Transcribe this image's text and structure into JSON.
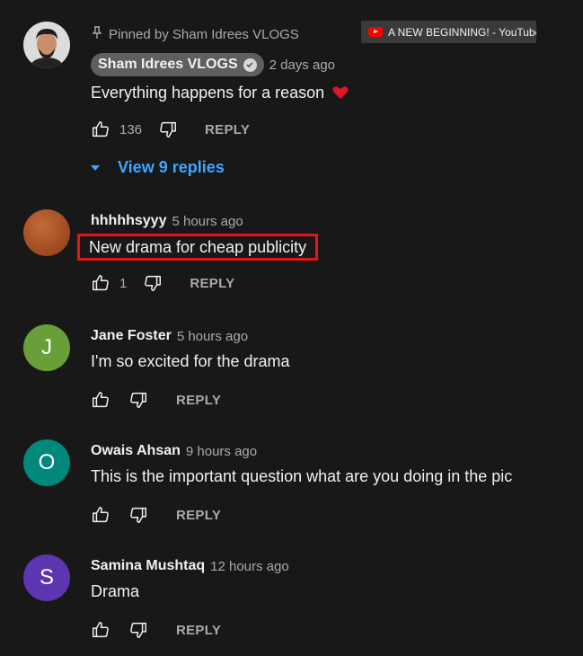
{
  "video_tab": {
    "title": "A NEW BEGINNING! - YouTube"
  },
  "pinned": {
    "pin_text": "Pinned by Sham Idrees VLOGS",
    "author": "Sham Idrees VLOGS",
    "time": "2 days ago",
    "text": "Everything happens for a reason",
    "likes": "136",
    "reply_label": "REPLY",
    "view_replies": "View 9 replies"
  },
  "comments": [
    {
      "author": "hhhhhsyyy",
      "time": "5 hours ago",
      "text": "New drama for cheap publicity",
      "likes": "1",
      "reply_label": "REPLY",
      "avatar_letter": "",
      "avatar_color": "#b8582a"
    },
    {
      "author": "Jane Foster",
      "time": "5 hours ago",
      "text": "I'm so excited for the drama",
      "likes": "",
      "reply_label": "REPLY",
      "avatar_letter": "J",
      "avatar_color": "#689f38"
    },
    {
      "author": "Owais Ahsan",
      "time": "9 hours ago",
      "text": "This is the important question what are you doing in the pic",
      "likes": "",
      "reply_label": "REPLY",
      "avatar_letter": "O",
      "avatar_color": "#00897b"
    },
    {
      "author": "Samina Mushtaq",
      "time": "12 hours ago",
      "text": "Drama",
      "likes": "",
      "reply_label": "REPLY",
      "avatar_letter": "S",
      "avatar_color": "#5e35b1"
    }
  ],
  "icons": {
    "like": "thumbs-up-icon",
    "dislike": "thumbs-down-icon",
    "pin": "pin-icon",
    "verified": "check-icon",
    "heart": "heart-icon"
  },
  "colors": {
    "background": "#181818",
    "link": "#3ea6ff",
    "highlight": "#e3151b"
  }
}
